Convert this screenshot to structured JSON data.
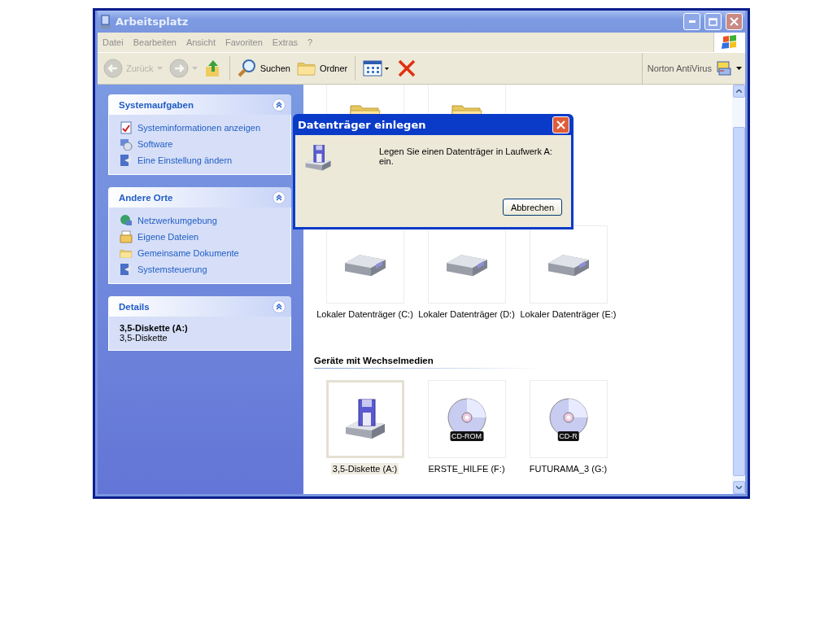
{
  "window": {
    "title": "Arbeitsplatz"
  },
  "menu": [
    "Datei",
    "Bearbeiten",
    "Ansicht",
    "Favoriten",
    "Extras",
    "?"
  ],
  "toolbar": [
    {
      "kind": "back",
      "label": "Zurück",
      "disabled": true
    },
    {
      "kind": "forward",
      "disabled": true
    },
    {
      "kind": "up",
      "disabled": false
    },
    {
      "kind": "search",
      "label": "Suchen",
      "disabled": false
    },
    {
      "kind": "folders",
      "label": "Ordner",
      "disabled": false
    },
    {
      "kind": "views",
      "disabled": false
    },
    {
      "kind": "delete",
      "disabled": false
    }
  ],
  "norton": {
    "label": "Norton AntiVirus"
  },
  "sidebar": [
    {
      "kind": "links",
      "title": "Systemaufgaben",
      "expanded": true,
      "items": [
        "Systeminformationen anzeigen",
        "Software",
        "Eine Einstellung ändern"
      ]
    },
    {
      "kind": "links",
      "title": "Andere Orte",
      "expanded": true,
      "items": [
        "Netzwerkumgebung",
        "Eigene Dateien",
        "Gemeinsame Dokumente",
        "Systemsteuerung"
      ]
    },
    {
      "kind": "details",
      "title": "Details",
      "expanded": true,
      "name": "3,5-Diskette (A:)",
      "description": "3,5-Diskette"
    }
  ],
  "hard_disks": [
    {
      "kind": "hdd",
      "label": "Lokaler Datenträger (C:)",
      "selected": false
    },
    {
      "kind": "hdd",
      "label": "Lokaler Datenträger (D:)",
      "selected": false
    },
    {
      "kind": "hdd",
      "label": "Lokaler Datenträger (E:)",
      "selected": false
    }
  ],
  "removable": {
    "heading": "Geräte mit Wechselmedien",
    "items": [
      {
        "kind": "floppy",
        "label": "3,5-Diskette (A:)",
        "selected": true
      },
      {
        "kind": "cd",
        "badge": "CD-ROM",
        "label": "ERSTE_HILFE (F:)",
        "selected": false
      },
      {
        "kind": "cd",
        "badge": "CD-R",
        "label": "FUTURAMA_3 (G:)",
        "selected": false
      }
    ]
  },
  "dialog": {
    "title": "Datenträger einlegen",
    "message": "Legen Sie einen Datenträger in Laufwerk A: ein.",
    "button": "Abbrechen"
  }
}
